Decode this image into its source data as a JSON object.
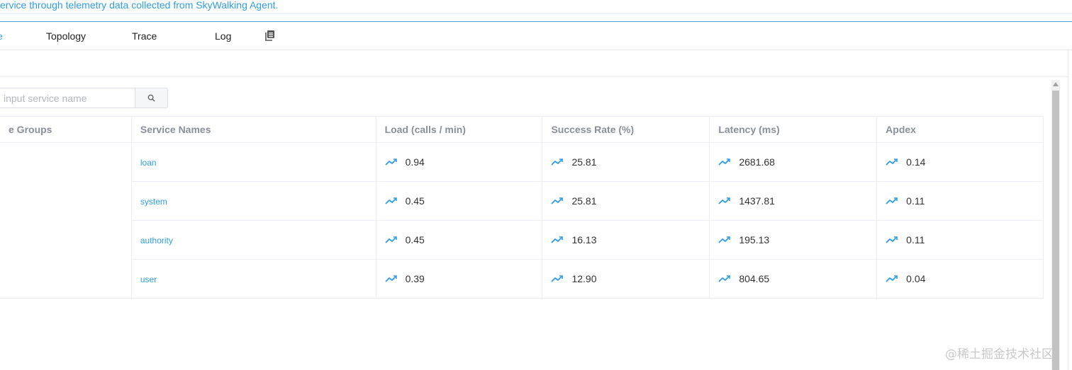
{
  "description": "ervice through telemetry data collected from SkyWalking Agent.",
  "tabs": [
    {
      "label": "e",
      "active": true
    },
    {
      "label": "Topology",
      "active": false
    },
    {
      "label": "Trace",
      "active": false
    },
    {
      "label": "Log",
      "active": false
    }
  ],
  "tab_icon": "copy-icon",
  "search": {
    "placeholder": "input service name",
    "value": "",
    "button_icon": "search-icon"
  },
  "table": {
    "headers": [
      "e Groups",
      "Service Names",
      "Load (calls / min)",
      "Success Rate (%)",
      "Latency (ms)",
      "Apdex"
    ],
    "group": "",
    "rows": [
      {
        "service": "loan",
        "load": "0.94",
        "success_rate": "25.81",
        "latency": "2681.68",
        "apdex": "0.14"
      },
      {
        "service": "system",
        "load": "0.45",
        "success_rate": "25.81",
        "latency": "1437.81",
        "apdex": "0.11"
      },
      {
        "service": "authority",
        "load": "0.45",
        "success_rate": "16.13",
        "latency": "195.13",
        "apdex": "0.11"
      },
      {
        "service": "user",
        "load": "0.39",
        "success_rate": "12.90",
        "latency": "804.65",
        "apdex": "0.04"
      }
    ]
  },
  "watermark": "@稀土掘金技术社区",
  "colors": {
    "accent": "#2f9ee8",
    "header_text": "#8a8f99",
    "border": "#ebeef5"
  }
}
